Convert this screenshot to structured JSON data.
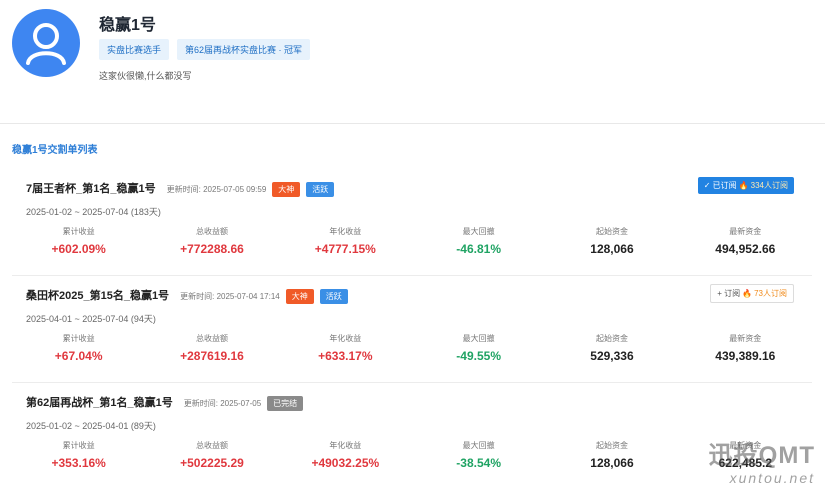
{
  "profile": {
    "name": "稳赢1号",
    "tags": [
      "实盘比赛选手",
      "第62届再战杯实盘比赛 · 冠军"
    ],
    "bio": "这家伙很懒,什么都没写"
  },
  "section_title": "稳赢1号交割单列表",
  "metric_labels": [
    "累计收益",
    "总收益额",
    "年化收益",
    "最大回撤",
    "起始资金",
    "最新资金"
  ],
  "records": [
    {
      "title": "7届王者杯_第1名_稳赢1号",
      "update_time": "更新时间: 2025-07-05 09:59",
      "badges": [
        "大神",
        "活跃"
      ],
      "date_range": "2025-01-02 ~ 2025-07-04 (183天)",
      "subscribe": {
        "label": "✓ 已订阅",
        "count": "334人订阅",
        "subscribed": true
      },
      "metrics": [
        "+602.09%",
        "+772288.66",
        "+4777.15%",
        "-46.81%",
        "128,066",
        "494,952.66"
      ]
    },
    {
      "title": "桑田杯2025_第15名_稳赢1号",
      "update_time": "更新时间: 2025-07-04 17:14",
      "badges": [
        "大神",
        "活跃"
      ],
      "date_range": "2025-04-01 ~ 2025-07-04 (94天)",
      "subscribe": {
        "label": "+ 订阅",
        "count": "73人订阅",
        "subscribed": false
      },
      "metrics": [
        "+67.04%",
        "+287619.16",
        "+633.17%",
        "-49.55%",
        "529,336",
        "439,389.16"
      ]
    },
    {
      "title": "第62届再战杯_第1名_稳赢1号",
      "update_time": "更新时间: 2025-07-05",
      "badges": [
        "已完结"
      ],
      "date_range": "2025-01-02 ~ 2025-04-01 (89天)",
      "subscribe": null,
      "metrics": [
        "+353.16%",
        "+502225.29",
        "+49032.25%",
        "-38.54%",
        "128,066",
        "622,485.2"
      ]
    }
  ],
  "watermark": {
    "main": "迅投QMT",
    "sub": "xuntou.net"
  },
  "colors": {
    "accent": "#2f7fd7",
    "positive": "#e0383e",
    "negative": "#1fa363",
    "badge_red": "#f05a28",
    "badge_blue": "#3a8fe6",
    "badge_gray": "#8a8a8a"
  },
  "icons": {
    "avatar": "user-icon",
    "flame": "flame-icon",
    "check": "check-icon"
  }
}
